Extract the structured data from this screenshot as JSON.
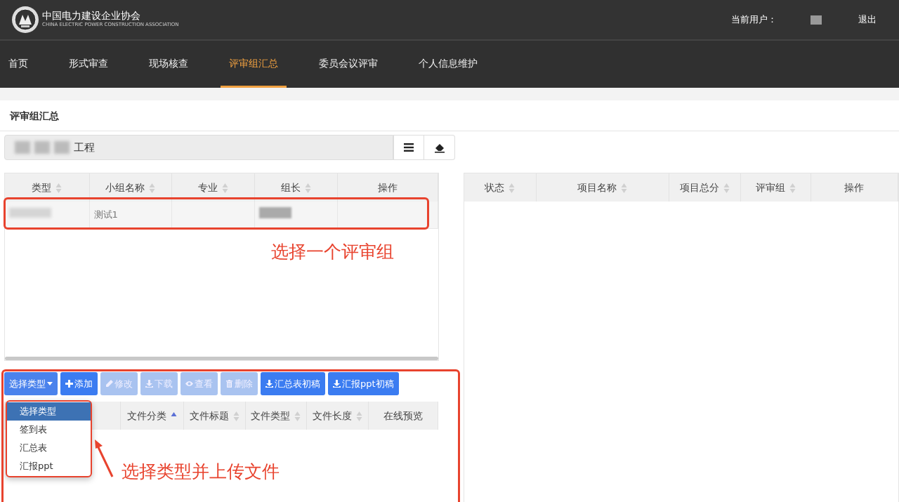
{
  "header": {
    "logo_name": "中国电力建设企业协会",
    "logo_subtitle": "CHINA ELECTRIC POWER CONSTRUCTION ASSOCIATION",
    "user_label": "当前用户：",
    "logout": "退出"
  },
  "nav": [
    {
      "label": "首页",
      "selected": false
    },
    {
      "label": "形式审查",
      "selected": false
    },
    {
      "label": "现场核查",
      "selected": false
    },
    {
      "label": "评审组汇总",
      "selected": true
    },
    {
      "label": "委员会议评审",
      "selected": false
    },
    {
      "label": "个人信息维护",
      "selected": false
    }
  ],
  "page_title": "评审组汇总",
  "project_field": {
    "value": "工程"
  },
  "groups_table": {
    "columns": [
      {
        "label": "类型",
        "sortable": true,
        "sorted": false
      },
      {
        "label": "小组名称",
        "sortable": true,
        "sorted": false
      },
      {
        "label": "专业",
        "sortable": true,
        "sorted": false
      },
      {
        "label": "组长",
        "sortable": true,
        "sorted": false
      },
      {
        "label": "操作",
        "sortable": false
      }
    ],
    "rows": [
      {
        "group_name": "测试1"
      }
    ]
  },
  "toolbar": [
    {
      "label": "选择类型",
      "kind": "dropdown",
      "disabled": false
    },
    {
      "label": "添加",
      "kind": "button",
      "disabled": false
    },
    {
      "label": "修改",
      "kind": "button",
      "disabled": true
    },
    {
      "label": "下载",
      "kind": "button",
      "disabled": true
    },
    {
      "label": "查看",
      "kind": "button",
      "disabled": true
    },
    {
      "label": "删除",
      "kind": "button",
      "disabled": true
    },
    {
      "label": "汇总表初稿",
      "kind": "button",
      "disabled": false
    },
    {
      "label": "汇报ppt初稿",
      "kind": "button",
      "disabled": false
    }
  ],
  "type_menu": [
    {
      "label": "选择类型",
      "selected": true
    },
    {
      "label": "签到表",
      "selected": false
    },
    {
      "label": "汇总表",
      "selected": false
    },
    {
      "label": "汇报ppt",
      "selected": false
    }
  ],
  "files_table": {
    "columns": [
      {
        "label": "文件分类",
        "sortable": true,
        "sorted": true
      },
      {
        "label": "文件标题",
        "sortable": true,
        "sorted": false
      },
      {
        "label": "文件类型",
        "sortable": true,
        "sorted": false
      },
      {
        "label": "文件长度",
        "sortable": true,
        "sorted": false
      },
      {
        "label": "在线预览",
        "sortable": false
      }
    ]
  },
  "projects_table": {
    "columns": [
      {
        "label": "状态",
        "sortable": true,
        "sorted": false
      },
      {
        "label": "项目名称",
        "sortable": true,
        "sorted": false
      },
      {
        "label": "项目总分",
        "sortable": true,
        "sorted": false
      },
      {
        "label": "评审组",
        "sortable": true,
        "sorted": false
      },
      {
        "label": "操作",
        "sortable": false
      }
    ]
  },
  "annotations": [
    {
      "text": "选择一个评审组"
    },
    {
      "text": "选择类型并上传文件"
    }
  ]
}
